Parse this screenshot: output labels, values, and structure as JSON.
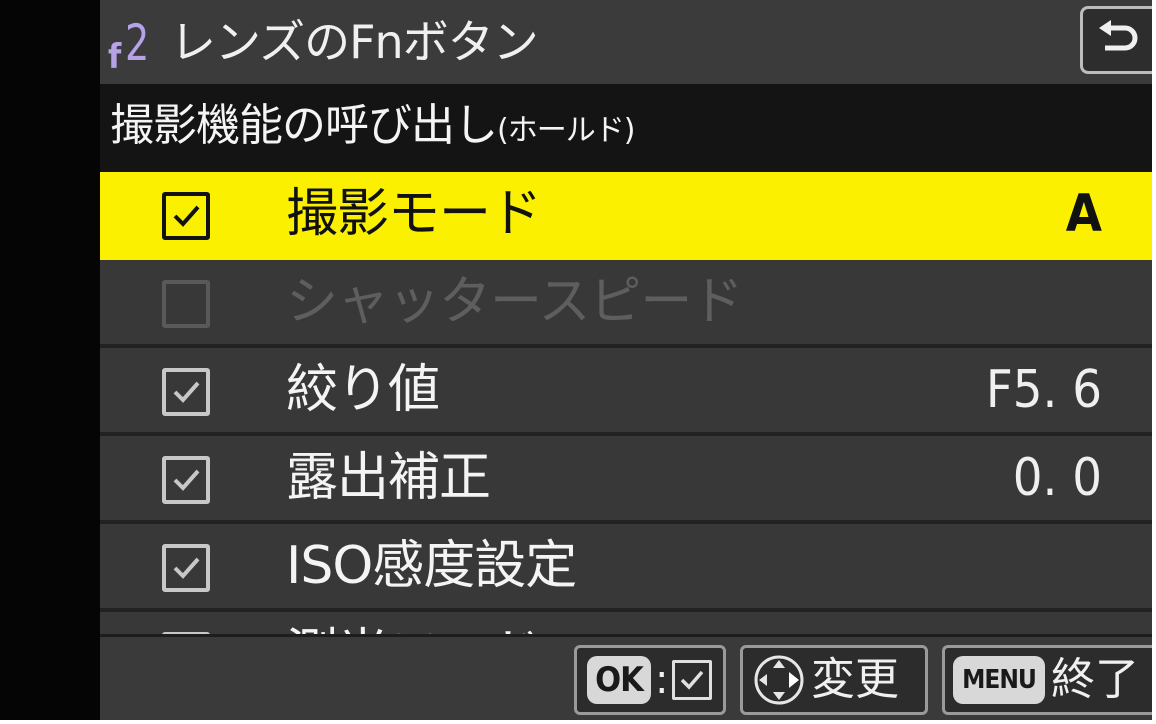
{
  "header": {
    "menu_code_letter": "f",
    "menu_code_number": "2",
    "title": "レンズのFnボタン",
    "back_icon": "return-arrow-icon"
  },
  "section": {
    "title_main": "撮影機能の呼び出し",
    "title_suffix": "(ホールド)"
  },
  "items": [
    {
      "label": "撮影モード",
      "value": "A",
      "checked": true,
      "selected": true,
      "disabled": false
    },
    {
      "label": "シャッタースピード",
      "value": "",
      "checked": false,
      "selected": false,
      "disabled": true
    },
    {
      "label": "絞り値",
      "value": "F5. 6",
      "checked": true,
      "selected": false,
      "disabled": false
    },
    {
      "label": "露出補正",
      "value": "0. 0",
      "checked": true,
      "selected": false,
      "disabled": false
    },
    {
      "label": "ISO感度設定",
      "value": "",
      "checked": true,
      "selected": false,
      "disabled": false
    },
    {
      "label": "測光モード",
      "value": "",
      "checked": true,
      "selected": false,
      "disabled": false
    }
  ],
  "footer": {
    "ok_button": {
      "key": "OK",
      "separator": ":",
      "icon": "checkbox-icon"
    },
    "change_button": {
      "icon": "multi-selector-icon",
      "label": "変更"
    },
    "menu_button": {
      "key": "MENU",
      "label": "終了"
    }
  },
  "colors": {
    "highlight": "#fbf000",
    "menu_code": "#b7a2e8",
    "background": "#383838"
  }
}
